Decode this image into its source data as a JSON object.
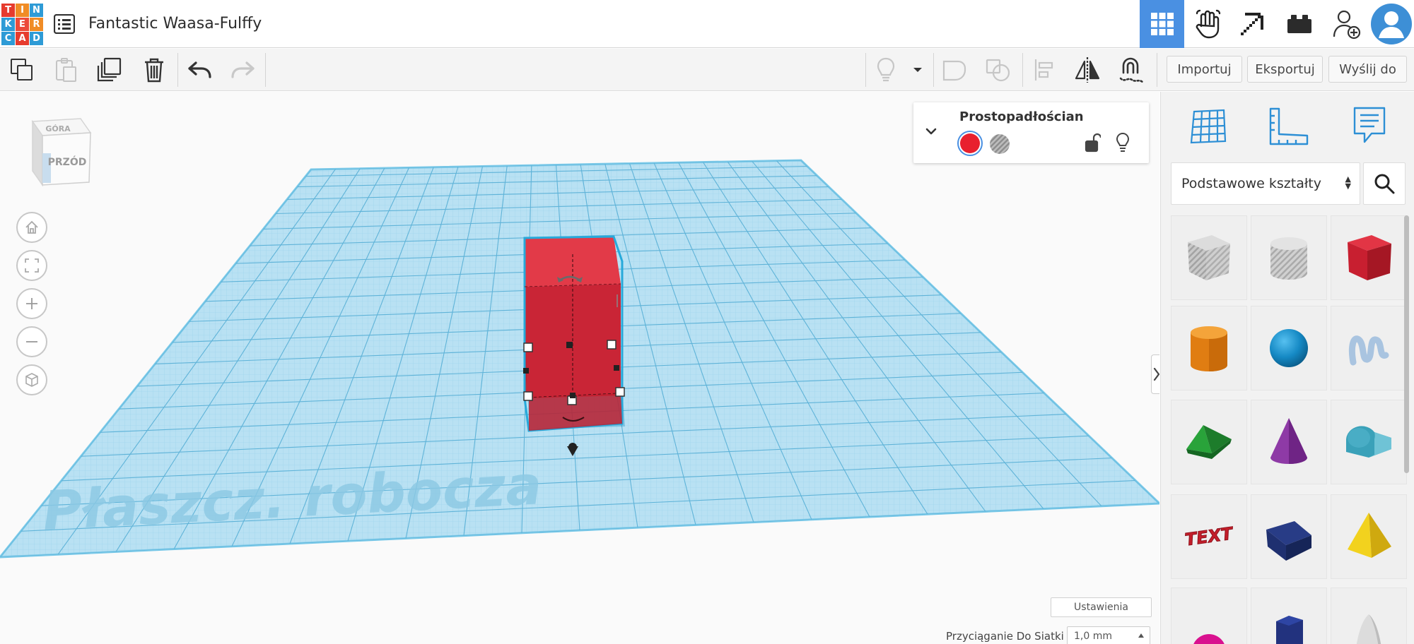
{
  "app": {
    "logo_letters": [
      "T",
      "I",
      "N",
      "K",
      "E",
      "R",
      "C",
      "A",
      "D"
    ],
    "logo_colors": [
      "#e63b2e",
      "#f08c26",
      "#2e9bd6",
      "#2e9bd6",
      "#ec4a3a",
      "#f08c26",
      "#2e9bd6",
      "#e63b2e",
      "#2e9bd6"
    ],
    "project_title": "Fantastic Waasa-Fulffy"
  },
  "header_icons": [
    "design-3d-icon",
    "simulation-hand-icon",
    "minecraft-pickaxe-icon",
    "bricks-icon",
    "add-user-icon",
    "avatar-icon"
  ],
  "toolbar": {
    "left_icons": [
      "copy-icon",
      "paste-icon",
      "duplicate-icon",
      "delete-icon",
      "undo-icon",
      "redo-icon"
    ],
    "right_icons": [
      "light-bulb-icon",
      "chevron-down-icon",
      "group-icon",
      "ungroup-icon",
      "align-icon",
      "mirror-icon",
      "magnet-icon"
    ],
    "import_label": "Importuj",
    "export_label": "Eksportuj",
    "send_label": "Wyślij do"
  },
  "workspace": {
    "view_cube_top": "GÓRA",
    "view_cube_front": "PRZÓD",
    "plane_label": "Płaszcz. robocza",
    "nav_icons": [
      "home-icon",
      "fit-view-icon",
      "zoom-in-icon",
      "zoom-out-icon",
      "perspective-icon"
    ],
    "settings_label": "Ustawienia",
    "snap_label": "Przyciąganie Do Siatki",
    "snap_value": "1,0 mm"
  },
  "shape_panel": {
    "name": "Prostopadłościan",
    "solid_color": "#e8202e"
  },
  "right_panel": {
    "tabs": [
      "workplane-grid-icon",
      "ruler-icon",
      "notes-icon"
    ],
    "library": "Podstawowe kształty",
    "shapes": [
      "box-hole",
      "cylinder-hole",
      "box",
      "cylinder",
      "sphere",
      "scribble",
      "roof",
      "cone",
      "round-roof",
      "text",
      "wedge",
      "pyramid",
      "half-sphere",
      "polygon",
      "paraboloid"
    ]
  },
  "colors": {
    "accent": "#4a90e2",
    "grid_plane": "#b8e0f2",
    "box_red": "#d8283a"
  }
}
